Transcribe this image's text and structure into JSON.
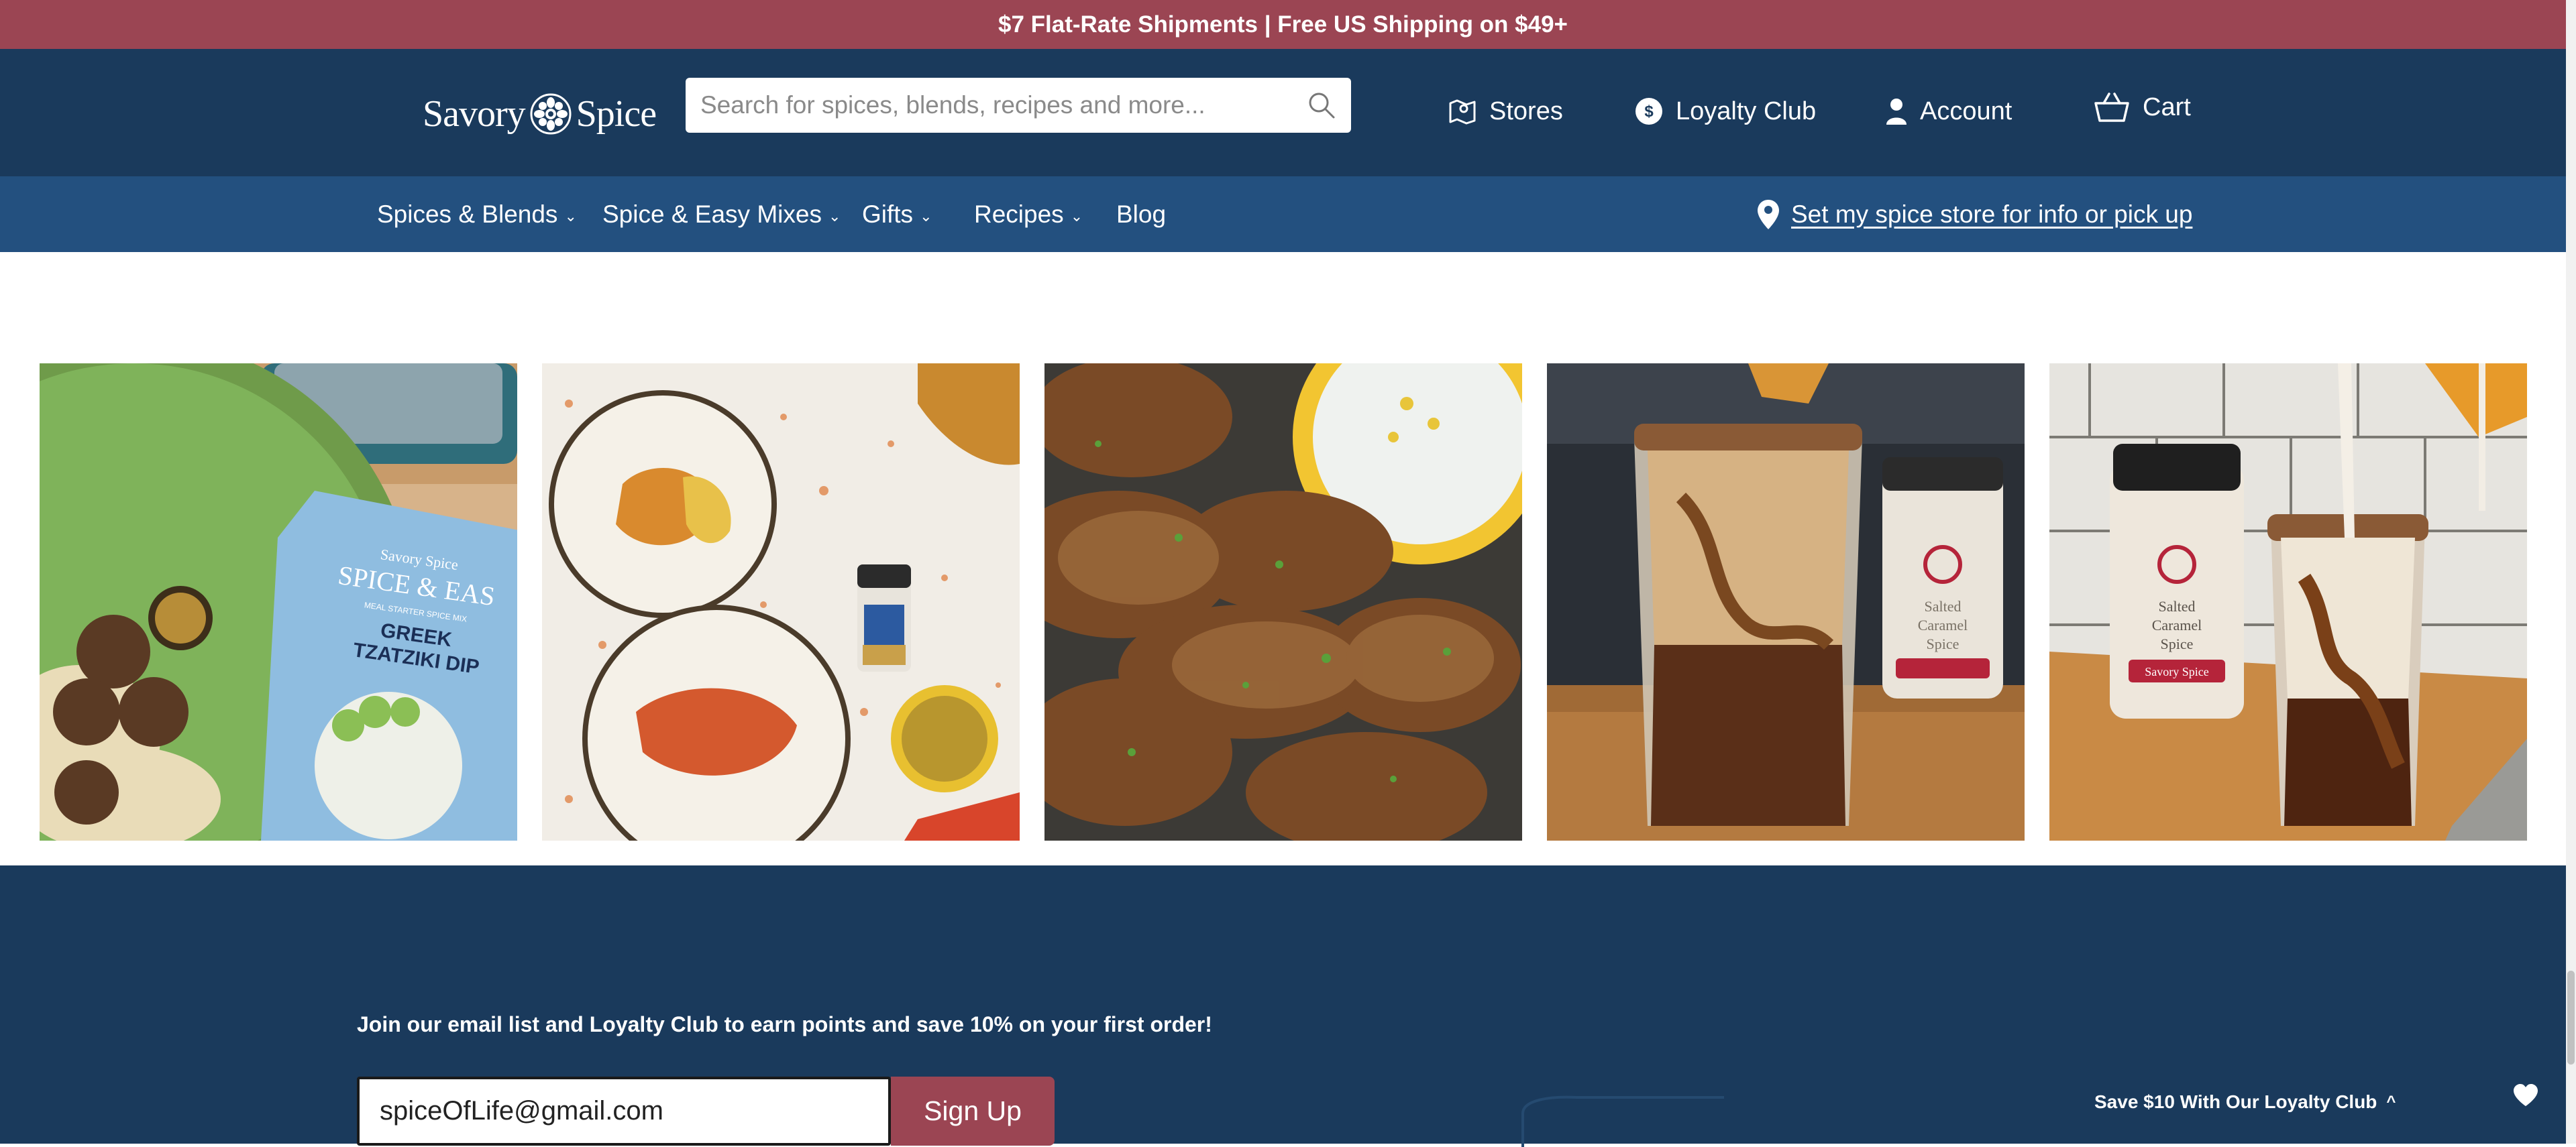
{
  "promo": {
    "text": "$7 Flat-Rate Shipments | Free US Shipping on $49+"
  },
  "header": {
    "logo": {
      "left": "Savory",
      "right": "Spice"
    },
    "search": {
      "placeholder": "Search for spices, blends, recipes and more...",
      "icon": "search-icon"
    },
    "links": {
      "stores": "Stores",
      "loyalty": "Loyalty Club",
      "account": "Account",
      "cart": "Cart"
    }
  },
  "nav": {
    "items": [
      {
        "label": "Spices & Blends",
        "chevron": "⌄"
      },
      {
        "label": "Spice & Easy Mixes",
        "chevron": "⌄"
      },
      {
        "label": "Gifts",
        "chevron": "⌄"
      },
      {
        "label": "Recipes",
        "chevron": "⌄"
      },
      {
        "label": "Blog"
      }
    ],
    "store_link": "Set my spice store for info or pick up"
  },
  "gallery": {
    "tiles": [
      {
        "alt": "Meatballs with orzo",
        "package_brand": "Savory Spice",
        "package_line": "SPICE & EAS",
        "package_sub": "MEAL STARTER SPICE MIX",
        "package_name_1": "GREEK",
        "package_name_2": "TZATZIKI DIP"
      },
      {
        "alt": "Roasted chicken plates"
      },
      {
        "alt": "Seasoned chicken wings"
      },
      {
        "alt": "Iced coffee with spice jar",
        "jar_text_1": "Salted",
        "jar_text_2": "Caramel",
        "jar_text_3": "Spice"
      },
      {
        "alt": "Iced coffee with salted caramel spice",
        "jar_text_1": "Salted",
        "jar_text_2": "Caramel",
        "jar_text_3": "Spice",
        "jar_brand": "Savory Spice"
      }
    ]
  },
  "footer": {
    "join_text": "Join our email list and Loyalty Club to earn points and save 10% on your first order!",
    "email_value": "spiceOfLife@gmail.com",
    "signup_label": "Sign Up",
    "loyalty_cta": "Save $10 With Our Loyalty Club",
    "loyalty_chevron": "^"
  },
  "colors": {
    "promo": "#9b4553",
    "header": "#1a3a5c",
    "nav": "#23507f",
    "accent": "#9b4553"
  }
}
